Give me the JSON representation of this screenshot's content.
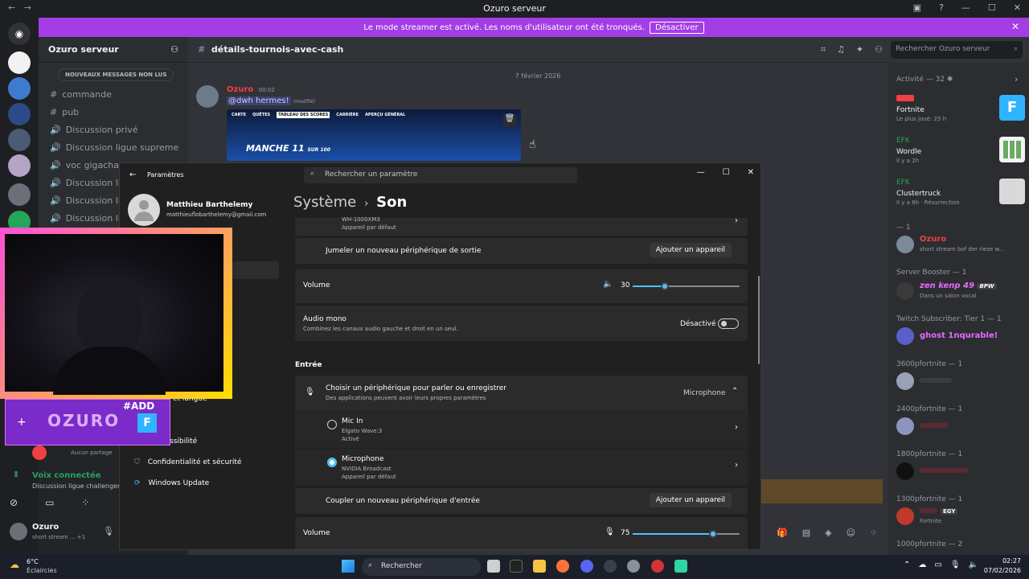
{
  "window": {
    "title": "Ozuro serveur"
  },
  "banner": {
    "text": "Le mode streamer est activé. Les noms d'utilisateur ont été tronqués.",
    "button": "Désactiver"
  },
  "server": {
    "name": "Ozuro serveur"
  },
  "channels": {
    "new_messages": "NOUVEAUX MESSAGES NON LUS",
    "items": [
      "commande",
      "pub",
      "Discussion privé",
      "Discussion ligue supreme",
      "voc gigacha",
      "Discussion li",
      "Discussion li",
      "Discussion li"
    ]
  },
  "chat": {
    "channel": "détails-tournois-avec-cash",
    "date_divider": "7 février 2026",
    "author": "Ozuro",
    "time": "00:02",
    "mention": "@dwh hermes!",
    "edited": "(modifié)",
    "embed_tabs": [
      "CARTE",
      "QUÊTES",
      "TABLEAU DES SCORES",
      "CARRIÈRE",
      "APERÇU GÉNÉRAL"
    ],
    "embed_title": "MANCHE 11",
    "embed_sub": "SUR 100"
  },
  "search": {
    "placeholder": "Rechercher Ozuro serveur"
  },
  "members": {
    "activity_header": "Activité — 32",
    "activities": [
      {
        "game": "Fortnite",
        "detail": "Le plus joué: 25 h"
      },
      {
        "user": "EFK",
        "game": "Wordle",
        "detail": "Il y a 2h"
      },
      {
        "user": "EFK",
        "game": "Clustertruck",
        "detail": "Il y a 8h · Résurrection"
      }
    ],
    "groups": [
      {
        "header": "— 1",
        "name": "Ozuro",
        "status": "short stream bof der riese w...",
        "color": "#f23f43"
      },
      {
        "header": "Server Booster — 1",
        "name": "zen kenp 49",
        "badge": "BPW",
        "status": "Dans un salon vocal",
        "color": "#e76bff"
      },
      {
        "header": "Twitch Subscriber: Tier 1 — 1",
        "name": "ghost 1nqurable!",
        "status": "",
        "color": "#e76bff"
      },
      {
        "header": "3600pfortnite — 1",
        "name": "",
        "status": "",
        "color": "#f2f3f5"
      },
      {
        "header": "2400pfortnite — 1",
        "name": "",
        "status": "",
        "color": "#f23f43"
      },
      {
        "header": "1800pfortnite — 1",
        "name": "",
        "status": "",
        "color": "#f23f43"
      },
      {
        "header": "1300pfortnite — 1",
        "name": "",
        "badge": "EGY",
        "status": "Fortnite",
        "color": "#f23f43"
      },
      {
        "header": "1000pfortnite — 2",
        "name": "",
        "status": "",
        "color": "#f2f3f5"
      }
    ]
  },
  "voice": {
    "status": "Voix connectée",
    "channel": "Discussion ligue challenger /",
    "no_share": "Aucun partage"
  },
  "user": {
    "name": "Ozuro",
    "status": "short stream ...",
    "extra": "+1"
  },
  "settings": {
    "app_title": "Paramètres",
    "search_placeholder": "Rechercher un paramètre",
    "account_name": "Matthieu Barthelemy",
    "account_email": "matthieuflobarthelemy@gmail.com",
    "breadcrumb_parent": "Système",
    "breadcrumb_current": "Son",
    "nav": [
      "et langue",
      "ssibilité",
      "Confidentialité et sécurité",
      "Windows Update"
    ],
    "output_device_name": "WH-1000XM3",
    "output_device_sub": "Appareil par défaut",
    "pair_output": "Jumeler un nouveau périphérique de sortie",
    "add_device": "Ajouter un appareil",
    "volume_label": "Volume",
    "output_volume": 30,
    "mono_title": "Audio mono",
    "mono_desc": "Combinez les canaux audio gauche et droit en un seul.",
    "mono_state": "Désactivé",
    "input_section": "Entrée",
    "choose_input_title": "Choisir un périphérique pour parler ou enregistrer",
    "choose_input_desc": "Des applications peuvent avoir leurs propres paramètres",
    "selected_input": "Microphone",
    "inputs": [
      {
        "name": "Mic In",
        "sub": "Elgato Wave:3",
        "sub2": "Activé",
        "selected": false
      },
      {
        "name": "Microphone",
        "sub": "NVIDIA Broadcast",
        "sub2": "Appareil par défaut",
        "selected": true
      }
    ],
    "pair_input": "Coupler un nouveau périphérique d'entrée",
    "input_volume": 75
  },
  "overlay": {
    "tag": "#ADD",
    "logo": "OZURO"
  },
  "taskbar": {
    "weather_temp": "6°C",
    "weather_text": "Éclaircies",
    "search": "Rechercher",
    "time": "02:27",
    "date": "07/02/2026"
  }
}
